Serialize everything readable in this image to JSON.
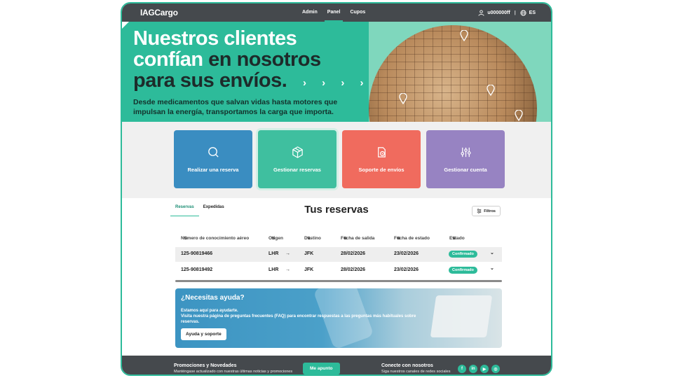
{
  "nav": {
    "logo": "IAGCargo",
    "links": [
      "Admin",
      "Panel",
      "Cupos"
    ],
    "active_link": "Panel",
    "user": "u000000ff",
    "language": "ES"
  },
  "hero": {
    "title_line1": "Nuestros clientes",
    "title_line2_a": "confían",
    "title_line2_b": " en nosotros",
    "title_line3": "para sus envíos.",
    "subtitle": "Desde medicamentos que salvan vidas hasta motores que impulsan la energía, transportamos la carga que importa.",
    "chevrons": "› › › ›"
  },
  "tiles": [
    {
      "label": "Realizar una reserva",
      "icon": "search-icon"
    },
    {
      "label": "Gestionar reservas",
      "icon": "box-icon"
    },
    {
      "label": "Soporte de envíos",
      "icon": "support-icon"
    },
    {
      "label": "Gestionar cuenta",
      "icon": "sliders-icon"
    }
  ],
  "reservations": {
    "tabs": [
      "Reservas",
      "Expedidas"
    ],
    "active_tab": "Reservas",
    "title": "Tus reservas",
    "filters_label": "Filtros",
    "columns": [
      "Número de conocimiento aéreo",
      "Origen",
      "Destino",
      "Fecha de salida",
      "Fecha de estado",
      "Estado"
    ],
    "rows": [
      {
        "awb": "125-90819466",
        "origin": "LHR",
        "dest": "JFK",
        "departure": "28/02/2026",
        "status_date": "23/02/2026",
        "status": "Confirmado"
      },
      {
        "awb": "125-90819492",
        "origin": "LHR",
        "dest": "JFK",
        "departure": "28/02/2026",
        "status_date": "23/02/2026",
        "status": "Confirmado"
      }
    ]
  },
  "help": {
    "title": "¿Necesitas ayuda?",
    "line1": "Estamos aquí para ayudarte.",
    "line2": "Visita nuestra página de preguntas frecuentes (FAQ) para encontrar respuestas a las preguntas más habituales sobre reservas.",
    "button": "Ayuda y soporte"
  },
  "footer": {
    "promo_title": "Promociones y Novedades",
    "promo_sub": "Manténgase actualizado con nuestras últimas noticias y promociones",
    "subscribe": "Me apunto",
    "connect_title": "Conecte con nosotros",
    "connect_sub": "Siga nuestros canales de redes sociales",
    "socials": [
      "f",
      "in",
      "▶",
      "◎"
    ]
  },
  "colors": {
    "accent": "#2dbb9a",
    "nav": "#45494d",
    "tile_blue": "#3a8dc1",
    "tile_green": "#3fbf9f",
    "tile_red": "#f06b5e",
    "tile_purple": "#9783c2"
  }
}
